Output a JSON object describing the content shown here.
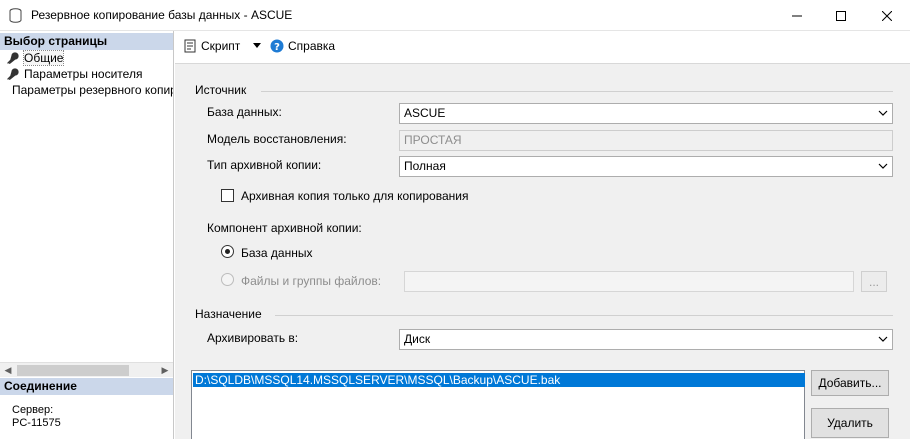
{
  "window": {
    "title": "Резервное копирование базы данных - ASCUE"
  },
  "sidebar": {
    "header": "Выбор страницы",
    "items": [
      {
        "label": "Общие"
      },
      {
        "label": "Параметры носителя"
      },
      {
        "label": "Параметры резервного копир"
      }
    ]
  },
  "connection": {
    "header": "Соединение",
    "server_label": "Сервер:",
    "server_value": "PC-11575"
  },
  "toolbar": {
    "script_label": "Скрипт",
    "help_label": "Справка"
  },
  "source": {
    "group_label": "Источник",
    "database_label": "База данных:",
    "database_value": "ASCUE",
    "recovery_label": "Модель восстановления:",
    "recovery_value": "ПРОСТАЯ",
    "backup_type_label": "Тип архивной копии:",
    "backup_type_value": "Полная",
    "copy_only_label": "Архивная копия только для копирования",
    "component_label": "Компонент архивной копии:",
    "radio_database": "База данных",
    "radio_files": "Файлы и группы файлов:",
    "browse_label": "..."
  },
  "destination": {
    "group_label": "Назначение",
    "backup_to_label": "Архивировать в:",
    "backup_to_value": "Диск",
    "paths": [
      "D:\\SQLDB\\MSSQL14.MSSQLSERVER\\MSSQL\\Backup\\ASCUE.bak"
    ],
    "add_button": "Добавить...",
    "remove_button": "Удалить"
  },
  "colors": {
    "selection": "#0078d7",
    "section_header": "#cbd7ea",
    "help_icon": "#1e7bd4"
  }
}
